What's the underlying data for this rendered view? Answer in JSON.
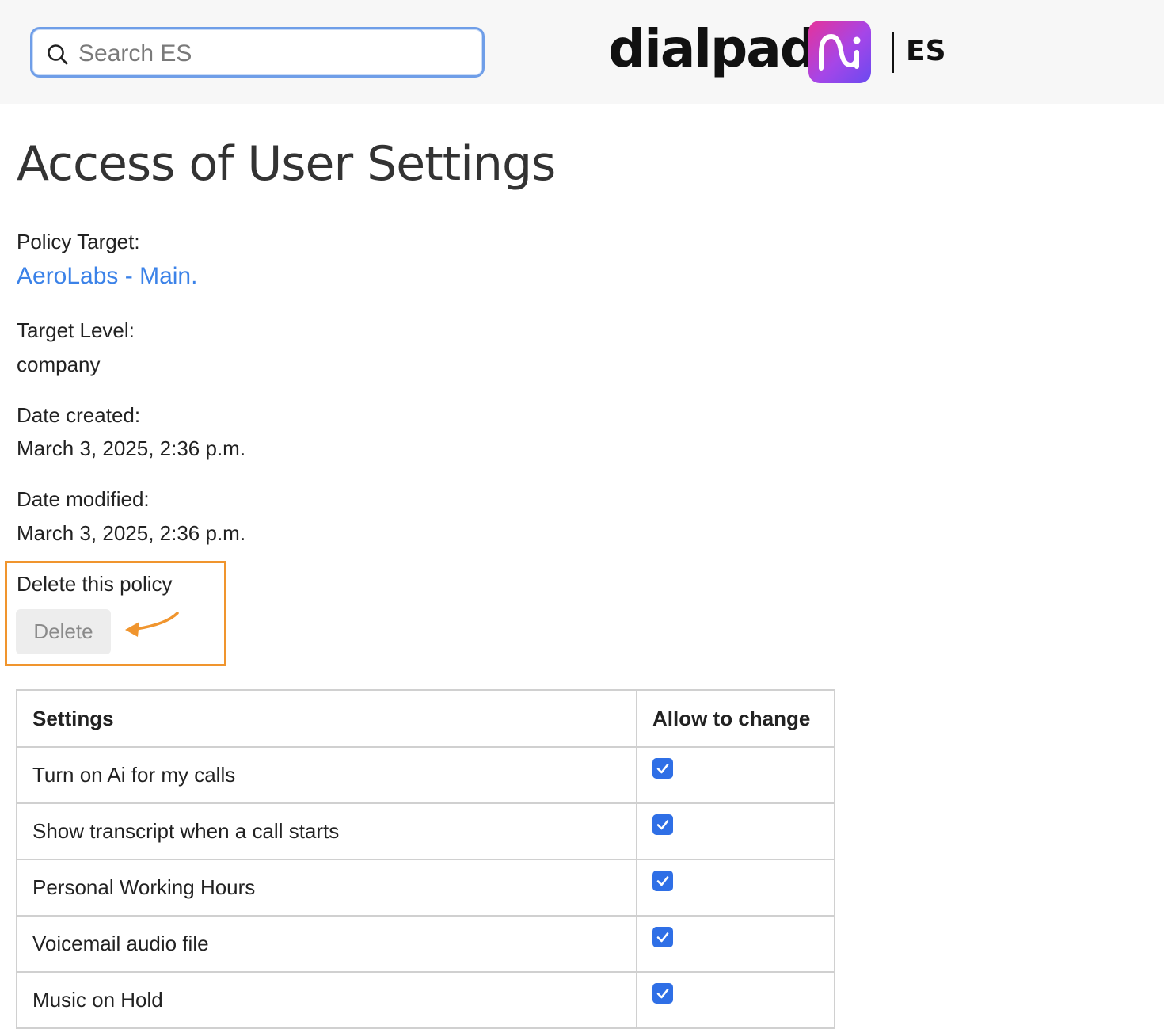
{
  "header": {
    "search_placeholder": "Search ES",
    "logo_text": "dialpad",
    "logo_badge": "Ai",
    "logo_suffix": "ES"
  },
  "page": {
    "title": "Access of User Settings"
  },
  "fields": {
    "policy_target_label": "Policy Target:",
    "policy_target_value": "AeroLabs - Main.",
    "target_level_label": "Target Level:",
    "target_level_value": "company",
    "date_created_label": "Date created:",
    "date_created_value": "March 3, 2025, 2:36 p.m.",
    "date_modified_label": "Date modified:",
    "date_modified_value": "March 3, 2025, 2:36 p.m."
  },
  "delete_section": {
    "label": "Delete this policy",
    "button_label": "Delete"
  },
  "table": {
    "headers": [
      "Settings",
      "Allow to change"
    ],
    "rows": [
      {
        "setting": "Turn on Ai for my calls",
        "allowed": true
      },
      {
        "setting": "Show transcript when a call starts",
        "allowed": true
      },
      {
        "setting": "Personal Working Hours",
        "allowed": true
      },
      {
        "setting": "Voicemail audio file",
        "allowed": true
      },
      {
        "setting": "Music on Hold",
        "allowed": true
      }
    ]
  },
  "colors": {
    "link": "#3b82e8",
    "highlight": "#f0952e",
    "checkbox": "#2f6fe6"
  }
}
